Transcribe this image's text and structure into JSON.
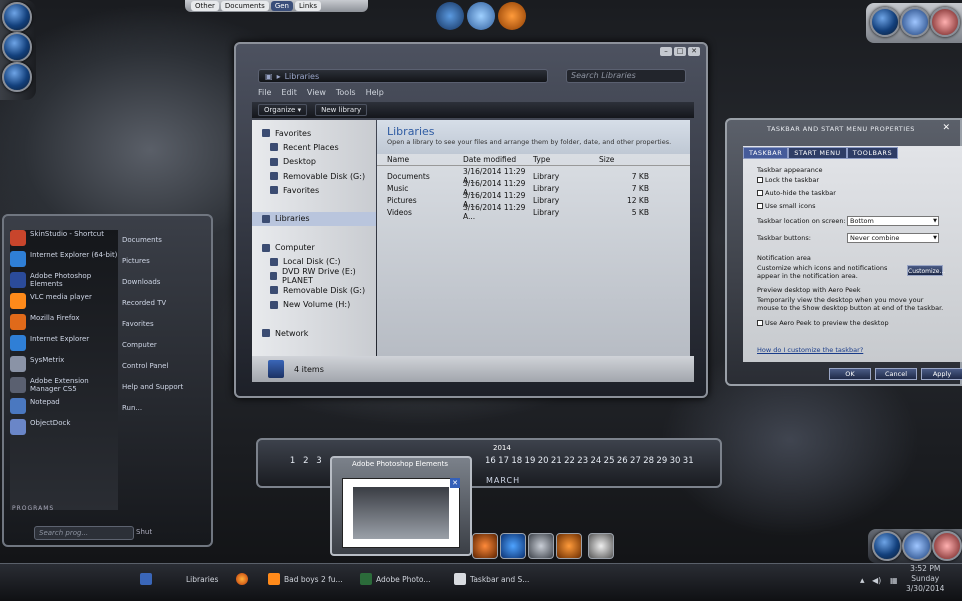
{
  "top_tabs": [
    "Other",
    "Documents",
    "Gen",
    "Links"
  ],
  "explorer": {
    "address": "Libraries",
    "search_placeholder": "Search Libraries",
    "menu": [
      "File",
      "Edit",
      "View",
      "Tools",
      "Help"
    ],
    "toolbar": [
      "Organize ▾",
      "New library"
    ],
    "nav": [
      {
        "label": "Favorites",
        "sub": false
      },
      {
        "label": "Recent Places",
        "sub": true
      },
      {
        "label": "Desktop",
        "sub": true
      },
      {
        "label": "Removable Disk (G:)",
        "sub": true
      },
      {
        "label": "Favorites",
        "sub": true
      },
      {
        "label": "",
        "sub": false
      },
      {
        "label": "Libraries",
        "sub": false
      },
      {
        "label": "",
        "sub": false
      },
      {
        "label": "Computer",
        "sub": false
      },
      {
        "label": "Local Disk (C:)",
        "sub": true
      },
      {
        "label": "DVD RW Drive (E:) PLANET",
        "sub": true
      },
      {
        "label": "Removable Disk (G:)",
        "sub": true
      },
      {
        "label": "New Volume (H:)",
        "sub": true
      },
      {
        "label": "",
        "sub": false
      },
      {
        "label": "Network",
        "sub": false
      }
    ],
    "content_title": "Libraries",
    "content_subtitle": "Open a library to see your files and arrange them by folder, date, and other properties.",
    "columns": [
      "Name",
      "Date modified",
      "Type",
      "Size"
    ],
    "rows": [
      [
        "Documents",
        "3/16/2014 11:29 A...",
        "Library",
        "7 KB"
      ],
      [
        "Music",
        "3/16/2014 11:29 A...",
        "Library",
        "7 KB"
      ],
      [
        "Pictures",
        "3/16/2014 11:29 A...",
        "Library",
        "12 KB"
      ],
      [
        "Videos",
        "3/16/2014 11:29 A...",
        "Library",
        "5 KB"
      ]
    ],
    "status": "4 items"
  },
  "props": {
    "title": "TASKBAR AND START MENU PROPERTIES",
    "tabs": [
      "TASKBAR",
      "START MENU",
      "TOOLBARS"
    ],
    "appearance_heading": "Taskbar appearance",
    "checks": [
      "Lock the taskbar",
      "Auto-hide the taskbar",
      "Use small icons"
    ],
    "location_label": "Taskbar location on screen:",
    "location_value": "Bottom",
    "buttons_label": "Taskbar buttons:",
    "buttons_value": "Never combine",
    "notif_heading": "Notification area",
    "notif_text": "Customize which icons and notifications appear in the notification area.",
    "customize": "Customize...",
    "peek_heading": "Preview desktop with Aero Peek",
    "peek_text": "Temporarily view the desktop when you move your mouse to the Show desktop button at end of the taskbar.",
    "peek_check": "Use Aero Peek to preview the desktop",
    "help_link": "How do I customize the taskbar?",
    "ok": "OK",
    "cancel": "Cancel",
    "apply": "Apply"
  },
  "startmenu": {
    "left": [
      "SkinStudio - Shortcut",
      "Internet Explorer (64-bit)",
      "Adobe Photoshop Elements",
      "VLC media player",
      "Mozilla Firefox",
      "Internet Explorer",
      "SysMetrix",
      "Adobe Extension Manager CS5",
      "Notepad",
      "ObjectDock"
    ],
    "right": [
      "Documents",
      "Pictures",
      "Downloads",
      "Recorded TV",
      "Favorites",
      "Computer",
      "Control Panel",
      "Help and Support",
      "Run..."
    ],
    "programs": "PROGRAMS",
    "search_placeholder": "Search prog...",
    "shutdown": "Shut"
  },
  "calendar": {
    "year": "2014",
    "days": [
      "1",
      "2",
      "3",
      "",
      "",
      "",
      "",
      "",
      "",
      "",
      "",
      "",
      "",
      "",
      "",
      "16",
      "17",
      "18",
      "19",
      "20",
      "21",
      "22",
      "23",
      "24",
      "25",
      "26",
      "27",
      "28",
      "29",
      "30",
      "31"
    ],
    "month": "MARCH"
  },
  "thumbnail_title": "Adobe Photoshop Elements",
  "taskbar": {
    "items": [
      "Libraries",
      "",
      "Bad boys 2 fu...",
      "Adobe Photo...",
      "Taskbar and S..."
    ],
    "clock_time": "3:52 PM",
    "clock_day": "Sunday",
    "clock_date": "3/30/2014"
  }
}
